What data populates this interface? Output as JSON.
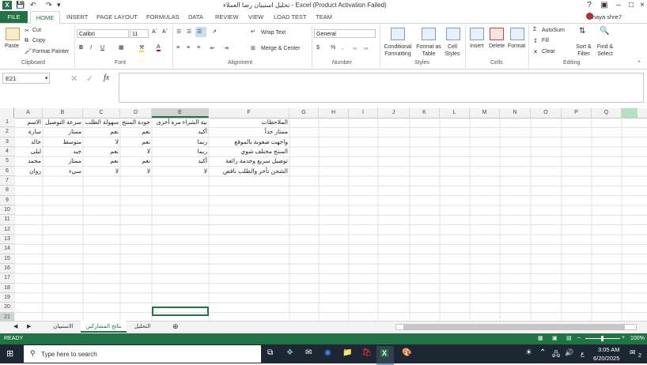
{
  "window": {
    "title": "تحليل استبيان رضا العملاء - Excel (Product Activation Failed)",
    "user": "haya shre7",
    "help": "?"
  },
  "tabs": [
    "FILE",
    "HOME",
    "INSERT",
    "PAGE LAYOUT",
    "FORMULAS",
    "DATA",
    "REVIEW",
    "VIEW",
    "LOAD TEST",
    "TEAM"
  ],
  "ribbon": {
    "clipboard": {
      "paste": "Paste",
      "cut": "Cut",
      "copy": "Copy",
      "format_painter": "Format Painter",
      "label": "Clipboard"
    },
    "font": {
      "name": "Calibri",
      "size": "11",
      "bold": "B",
      "italic": "I",
      "underline": "U",
      "label": "Font"
    },
    "alignment": {
      "wrap": "Wrap Text",
      "merge": "Merge & Center",
      "label": "Alignment"
    },
    "number": {
      "format": "General",
      "currency": "$",
      "percent": "%",
      "comma": ",",
      "label": "Number"
    },
    "styles": {
      "conditional": "Conditional Formatting",
      "format_table": "Format as Table",
      "cell_styles": "Cell Styles",
      "label": "Styles"
    },
    "cells": {
      "insert": "Insert",
      "delete": "Delete",
      "format": "Format",
      "label": "Cells"
    },
    "editing": {
      "autosum": "AutoSum",
      "fill": "Fill",
      "clear": "Clear",
      "sort": "Sort & Filter",
      "find": "Find & Select",
      "label": "Editing"
    }
  },
  "formula_bar": {
    "name_box": "E21",
    "fx": "fx",
    "value": ""
  },
  "columns": [
    "A",
    "B",
    "C",
    "D",
    "E",
    "F",
    "G",
    "H",
    "I",
    "J",
    "K",
    "L",
    "M",
    "N",
    "O",
    "P",
    "Q"
  ],
  "rows": [
    "1",
    "2",
    "3",
    "4",
    "5",
    "6",
    "7",
    "8",
    "9",
    "10",
    "11",
    "12",
    "13",
    "14",
    "15",
    "16",
    "17",
    "18",
    "19",
    "20",
    "21"
  ],
  "sheet": [
    [
      "الاسم",
      "سرعة التوصيل",
      "سهولة الطلب",
      "جودة المنتج",
      "نية الشراء مرة أخرى",
      "الملاحظات"
    ],
    [
      "سارة",
      "ممتاز",
      "نعم",
      "نعم",
      "أكيد",
      "ممتاز جداً"
    ],
    [
      "خالد",
      "متوسط",
      "لا",
      "نعم",
      "ربما",
      "واجهت صعوبة بالموقع"
    ],
    [
      "ليلى",
      "جيد",
      "نعم",
      "لا",
      "ربما",
      "المنتج مختلف شوي"
    ],
    [
      "محمد",
      "ممتاز",
      "نعم",
      "نعم",
      "أكيد",
      "توصيل سريع وخدمة رائعة"
    ],
    [
      "روان",
      "سيء",
      "لا",
      "لا",
      "لا",
      "الشحن تأخر والطلب ناقص"
    ]
  ],
  "sheet_tabs": [
    "الاستبيان",
    "نتائج المشاركين",
    "التحليل"
  ],
  "active_sheet": "نتائج المشاركين",
  "status": {
    "ready": "READY",
    "zoom": "100%"
  },
  "taskbar": {
    "search_placeholder": "Type here to search",
    "time": "3:05 AM",
    "date": "6/20/2025",
    "lang": "ع",
    "notifications": "2"
  }
}
